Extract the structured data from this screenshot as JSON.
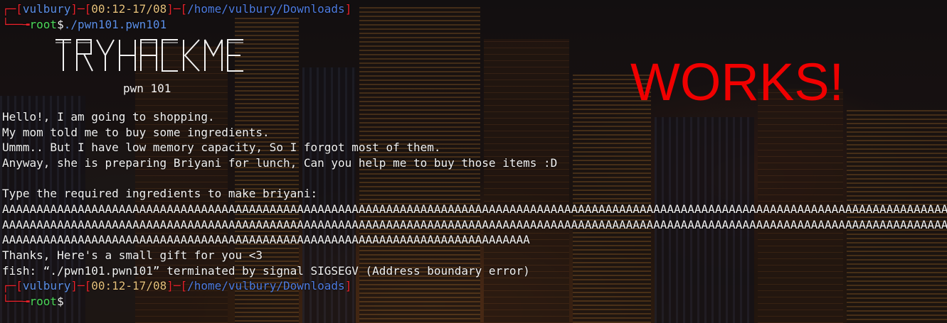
{
  "prompt": {
    "user": "vulbury",
    "time": "00:12-17/08",
    "path": "/home/vulbury/Downloads",
    "shell_user": "root",
    "dollar": "$"
  },
  "command": "./pwn101.pwn101",
  "banner": {
    "title": "TRYHACKME",
    "subtitle": "pwn 101"
  },
  "annotation": "WORKS!",
  "output": {
    "lines": [
      "Hello!, I am going to shopping.",
      "My mom told me to buy some ingredients.",
      "Ummm.. But I have low memory capacity, So I forgot most of them.",
      "Anyway, she is preparing Briyani for lunch, Can you help me to buy those items :D",
      "",
      "Type the required ingredients to make briyani:",
      "AAAAAAAAAAAAAAAAAAAAAAAAAAAAAAAAAAAAAAAAAAAAAAAAAAAAAAAAAAAAAAAAAAAAAAAAAAAAAAAAAAAAAAAAAAAAAAAAAAAAAAAAAAAAAAAAAAAAAAAAAAAAAAAAAAAAAAAAAAAAAAAAA",
      "AAAAAAAAAAAAAAAAAAAAAAAAAAAAAAAAAAAAAAAAAAAAAAAAAAAAAAAAAAAAAAAAAAAAAAAAAAAAAAAAAAAAAAAAAAAAAAAAAAAAAAAAAAAAAAAAAAAAAAAAAAAAAAAAAAAAAAAAAAAAAAAAA",
      "AAAAAAAAAAAAAAAAAAAAAAAAAAAAAAAAAAAAAAAAAAAAAAAAAAAAAAAAAAAAAAAAAAAAAAAAAAAAA",
      "Thanks, Here's a small gift for you <3",
      "fish: “./pwn101.pwn101” terminated by signal SIGSEGV (Address boundary error)"
    ]
  },
  "colors": {
    "prompt_red": "#e8222b",
    "prompt_user": "#5a8ee6",
    "prompt_time": "#e5c07b",
    "prompt_path": "#4d7be0",
    "root_green": "#4cd95a",
    "annotation_red": "#f00000"
  }
}
